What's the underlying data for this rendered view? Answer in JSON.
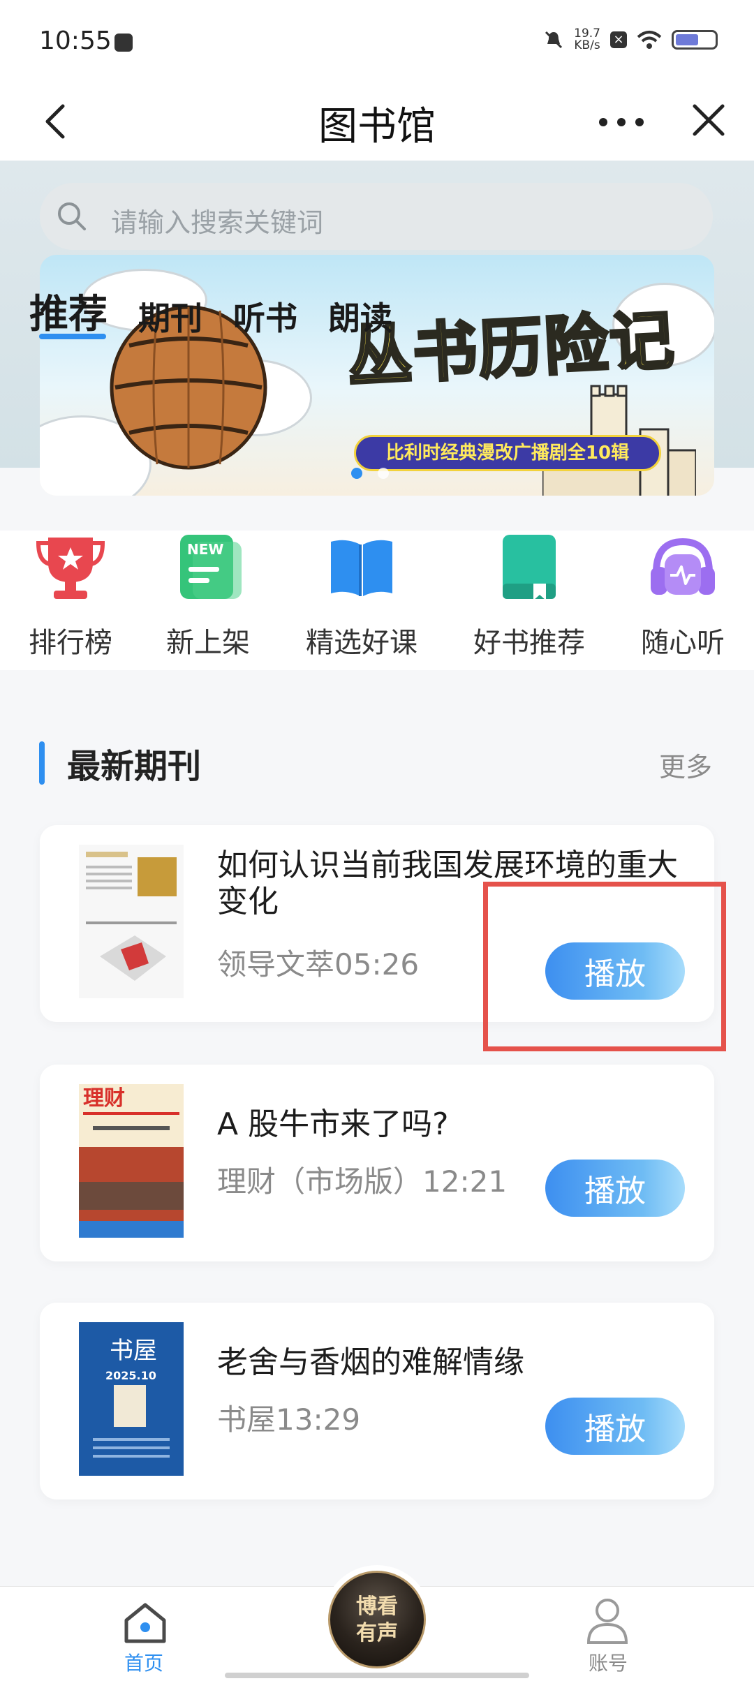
{
  "status_bar": {
    "time": "10:55",
    "net_speed_value": "19.7",
    "net_speed_unit": "KB/s",
    "battery_level": 0.6
  },
  "header": {
    "title": "图书馆",
    "more_icon": "more-dots-icon",
    "close_icon": "close-icon",
    "back_icon": "back-arrow-icon"
  },
  "search": {
    "placeholder": "请输入搜索关键词"
  },
  "category_tabs": [
    {
      "label": "推荐",
      "active": true
    },
    {
      "label": "期刊",
      "active": false
    },
    {
      "label": "听书",
      "active": false
    },
    {
      "label": "朗读",
      "active": false
    }
  ],
  "banner": {
    "title": "丛书历险记",
    "subtitle": "比利时经典漫改广播剧全10辑",
    "page_count": 2,
    "active_page": 1
  },
  "quick_links": [
    {
      "label": "排行榜",
      "icon": "trophy-icon",
      "color": "#e8474f"
    },
    {
      "label": "新上架",
      "icon": "new-document-icon",
      "color": "#35c47a"
    },
    {
      "label": "精选好课",
      "icon": "open-book-icon",
      "color": "#2e8ff0"
    },
    {
      "label": "好书推荐",
      "icon": "bookmark-book-icon",
      "color": "#28c0a0"
    },
    {
      "label": "随心听",
      "icon": "headphones-icon",
      "color": "#9c6ef0"
    }
  ],
  "section": {
    "title": "最新期刊",
    "more": "更多"
  },
  "periodicals": [
    {
      "title": "如何认识当前我国发展环境的重大变化",
      "meta": "领导文萃05:26",
      "action": "播放"
    },
    {
      "title": "A 股牛市来了吗?",
      "meta": "理财（市场版）12:21",
      "action": "播放"
    },
    {
      "title": "老舍与香烟的难解情缘",
      "meta": "书屋13:29",
      "action": "播放"
    }
  ],
  "bottom_nav": {
    "home_label": "首页",
    "center_label": "博看\n有声",
    "account_label": "账号"
  },
  "colors": {
    "accent": "#2e8ff0",
    "highlight": "#e5524b"
  }
}
